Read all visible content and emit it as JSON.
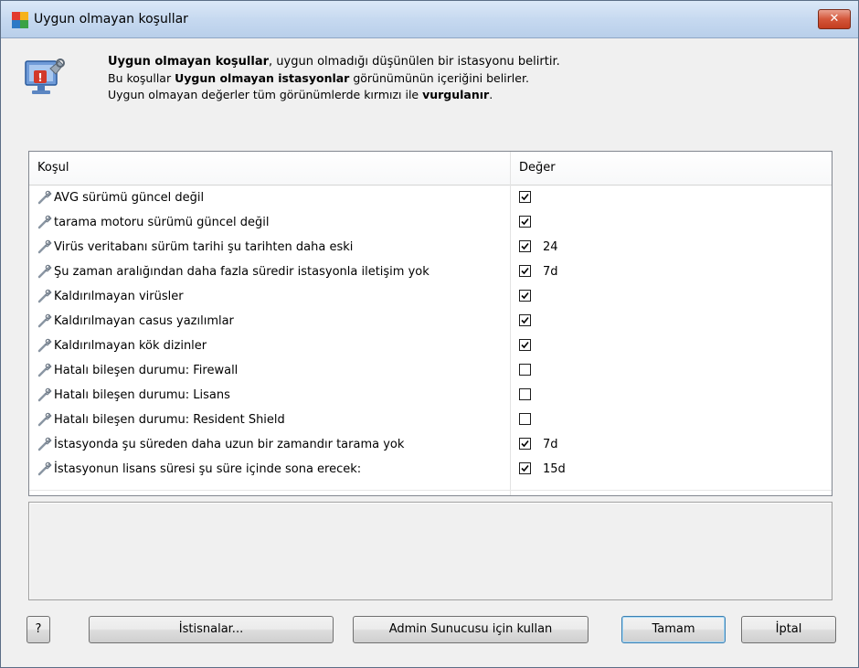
{
  "window": {
    "title": "Uygun olmayan koşullar",
    "close_label": "✕"
  },
  "description": {
    "line1_bold": "Uygun olmayan koşullar",
    "line1_rest": ", uygun olmadığı düşünülen bir istasyonu belirtir.",
    "line2_start": "Bu koşullar ",
    "line2_bold": "Uygun olmayan istasyonlar",
    "line2_rest": " görünümünün içeriğini belirler.",
    "line3_start": "Uygun olmayan değerler tüm görünümlerde kırmızı ile ",
    "line3_bold": "vurgulanır",
    "line3_end": "."
  },
  "table": {
    "columns": [
      "Koşul",
      "Değer"
    ],
    "rows": [
      {
        "label": "AVG sürümü güncel değil",
        "checked": true,
        "value": ""
      },
      {
        "label": "tarama motoru sürümü güncel değil",
        "checked": true,
        "value": ""
      },
      {
        "label": "Virüs veritabanı sürüm tarihi şu tarihten daha eski",
        "checked": true,
        "value": "24"
      },
      {
        "label": "Şu zaman aralığından daha fazla süredir istasyonla iletişim yok",
        "checked": true,
        "value": "7d"
      },
      {
        "label": "Kaldırılmayan virüsler",
        "checked": true,
        "value": ""
      },
      {
        "label": "Kaldırılmayan casus yazılımlar",
        "checked": true,
        "value": ""
      },
      {
        "label": "Kaldırılmayan kök dizinler",
        "checked": true,
        "value": ""
      },
      {
        "label": "Hatalı bileşen durumu: Firewall",
        "checked": false,
        "value": ""
      },
      {
        "label": "Hatalı bileşen durumu: Lisans",
        "checked": false,
        "value": ""
      },
      {
        "label": "Hatalı bileşen durumu: Resident Shield",
        "checked": false,
        "value": ""
      },
      {
        "label": "İstasyonda şu süreden daha uzun bir zamandır tarama yok",
        "checked": true,
        "value": "7d"
      },
      {
        "label": "İstasyonun lisans süresi şu süre içinde sona erecek:",
        "checked": true,
        "value": "15d"
      }
    ]
  },
  "buttons": {
    "help": "?",
    "exceptions": "İstisnalar...",
    "admin": "Admin Sunucusu için kullan",
    "ok": "Tamam",
    "cancel": "İptal"
  },
  "colors": {
    "titlebar": "#c6d9f0",
    "close_button": "#c33d1f",
    "window_bg": "#f0f0f0"
  }
}
